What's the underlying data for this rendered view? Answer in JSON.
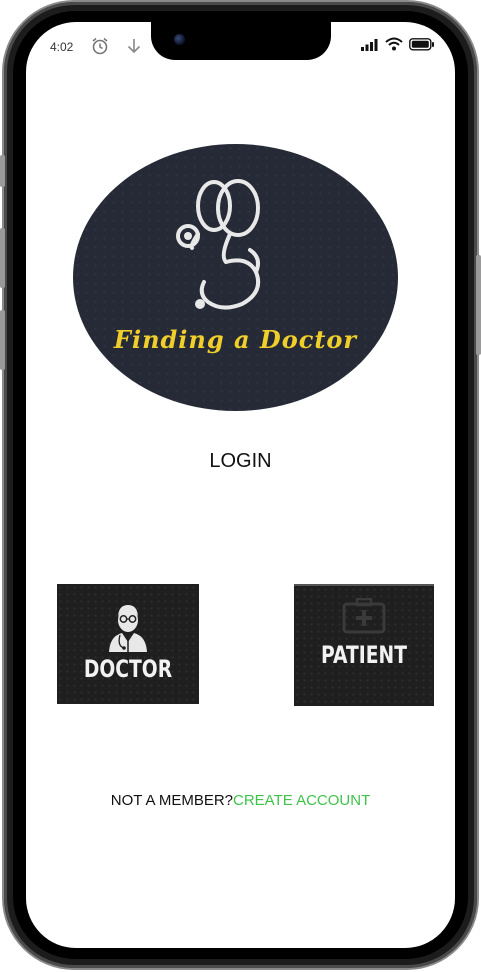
{
  "status_bar": {
    "time": "4:02",
    "icons": [
      "alarm-icon",
      "download-icon",
      "signal-icon",
      "wifi-icon",
      "battery-icon"
    ]
  },
  "logo": {
    "title": "Finding a Doctor",
    "icon": "stethoscope-icon",
    "background": "#252a36",
    "title_color": "#f1cf2a"
  },
  "login": {
    "title": "LOGIN"
  },
  "roles": {
    "doctor_label": "DOCTOR",
    "doctor_icon": "doctor-avatar-icon",
    "patient_label": "PATIENT",
    "patient_icon": "medical-kit-icon"
  },
  "footer": {
    "question": "NOT A MEMBER?",
    "link": "CREATE ACCOUNT",
    "link_color": "#3ec44a"
  }
}
